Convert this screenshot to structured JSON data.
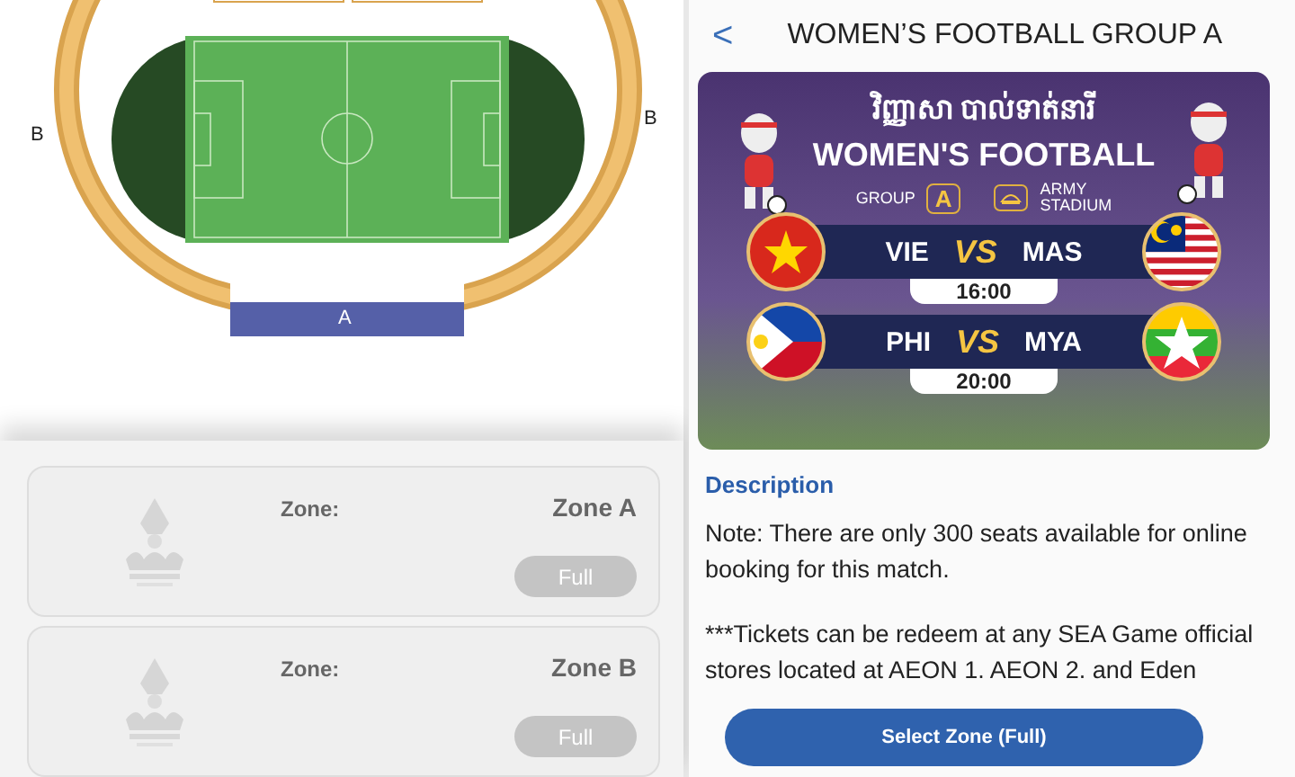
{
  "seat_map": {
    "left_label": "B",
    "right_label": "B",
    "bottom_label": "A"
  },
  "zone_list": [
    {
      "label": "Zone:",
      "zone": "Zone A",
      "button": "Full",
      "disabled": true
    },
    {
      "label": "Zone:",
      "zone": "Zone B",
      "button": "Full",
      "disabled": true
    }
  ],
  "header": {
    "back": "<",
    "title": "WOMEN’S FOOTBALL GROUP A"
  },
  "banner": {
    "khmer_title": "វិញ្ញាសា បាល់ទាត់នារី",
    "title": "WOMEN'S FOOTBALL",
    "group_label": "GROUP",
    "group": "A",
    "venue": [
      "ARMY",
      "STADIUM"
    ],
    "matches": [
      {
        "home": "VIE",
        "vs": "VS",
        "away": "MAS",
        "time": "16:00"
      },
      {
        "home": "PHI",
        "vs": "VS",
        "away": "MYA",
        "time": "20:00"
      }
    ]
  },
  "description": {
    "heading": "Description",
    "paragraphs": [
      "Note: There are only 300 seats available for online booking for this match.",
      "***Tickets can be redeem at any SEA Game official stores located at AEON 1. AEON 2. and Eden"
    ]
  },
  "select_button": {
    "label": "Select Zone (Full)",
    "disabled": false
  }
}
